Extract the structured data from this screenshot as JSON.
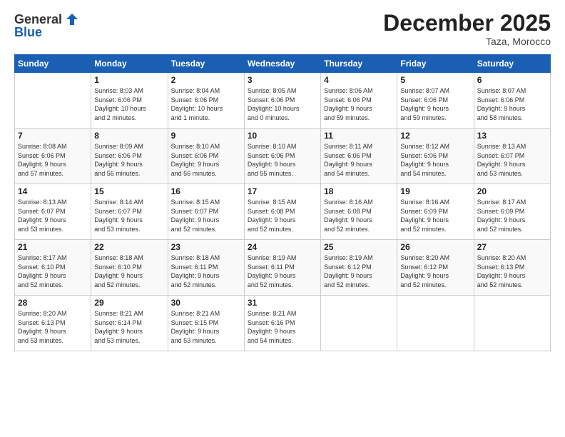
{
  "logo": {
    "general": "General",
    "blue": "Blue"
  },
  "header": {
    "month": "December 2025",
    "location": "Taza, Morocco"
  },
  "weekdays": [
    "Sunday",
    "Monday",
    "Tuesday",
    "Wednesday",
    "Thursday",
    "Friday",
    "Saturday"
  ],
  "weeks": [
    [
      {
        "day": "",
        "info": ""
      },
      {
        "day": "1",
        "info": "Sunrise: 8:03 AM\nSunset: 6:06 PM\nDaylight: 10 hours\nand 2 minutes."
      },
      {
        "day": "2",
        "info": "Sunrise: 8:04 AM\nSunset: 6:06 PM\nDaylight: 10 hours\nand 1 minute."
      },
      {
        "day": "3",
        "info": "Sunrise: 8:05 AM\nSunset: 6:06 PM\nDaylight: 10 hours\nand 0 minutes."
      },
      {
        "day": "4",
        "info": "Sunrise: 8:06 AM\nSunset: 6:06 PM\nDaylight: 9 hours\nand 59 minutes."
      },
      {
        "day": "5",
        "info": "Sunrise: 8:07 AM\nSunset: 6:06 PM\nDaylight: 9 hours\nand 59 minutes."
      },
      {
        "day": "6",
        "info": "Sunrise: 8:07 AM\nSunset: 6:06 PM\nDaylight: 9 hours\nand 58 minutes."
      }
    ],
    [
      {
        "day": "7",
        "info": "Sunrise: 8:08 AM\nSunset: 6:06 PM\nDaylight: 9 hours\nand 57 minutes."
      },
      {
        "day": "8",
        "info": "Sunrise: 8:09 AM\nSunset: 6:06 PM\nDaylight: 9 hours\nand 56 minutes."
      },
      {
        "day": "9",
        "info": "Sunrise: 8:10 AM\nSunset: 6:06 PM\nDaylight: 9 hours\nand 56 minutes."
      },
      {
        "day": "10",
        "info": "Sunrise: 8:10 AM\nSunset: 6:06 PM\nDaylight: 9 hours\nand 55 minutes."
      },
      {
        "day": "11",
        "info": "Sunrise: 8:11 AM\nSunset: 6:06 PM\nDaylight: 9 hours\nand 54 minutes."
      },
      {
        "day": "12",
        "info": "Sunrise: 8:12 AM\nSunset: 6:06 PM\nDaylight: 9 hours\nand 54 minutes."
      },
      {
        "day": "13",
        "info": "Sunrise: 8:13 AM\nSunset: 6:07 PM\nDaylight: 9 hours\nand 53 minutes."
      }
    ],
    [
      {
        "day": "14",
        "info": "Sunrise: 8:13 AM\nSunset: 6:07 PM\nDaylight: 9 hours\nand 53 minutes."
      },
      {
        "day": "15",
        "info": "Sunrise: 8:14 AM\nSunset: 6:07 PM\nDaylight: 9 hours\nand 53 minutes."
      },
      {
        "day": "16",
        "info": "Sunrise: 8:15 AM\nSunset: 6:07 PM\nDaylight: 9 hours\nand 52 minutes."
      },
      {
        "day": "17",
        "info": "Sunrise: 8:15 AM\nSunset: 6:08 PM\nDaylight: 9 hours\nand 52 minutes."
      },
      {
        "day": "18",
        "info": "Sunrise: 8:16 AM\nSunset: 6:08 PM\nDaylight: 9 hours\nand 52 minutes."
      },
      {
        "day": "19",
        "info": "Sunrise: 8:16 AM\nSunset: 6:09 PM\nDaylight: 9 hours\nand 52 minutes."
      },
      {
        "day": "20",
        "info": "Sunrise: 8:17 AM\nSunset: 6:09 PM\nDaylight: 9 hours\nand 52 minutes."
      }
    ],
    [
      {
        "day": "21",
        "info": "Sunrise: 8:17 AM\nSunset: 6:10 PM\nDaylight: 9 hours\nand 52 minutes."
      },
      {
        "day": "22",
        "info": "Sunrise: 8:18 AM\nSunset: 6:10 PM\nDaylight: 9 hours\nand 52 minutes."
      },
      {
        "day": "23",
        "info": "Sunrise: 8:18 AM\nSunset: 6:11 PM\nDaylight: 9 hours\nand 52 minutes."
      },
      {
        "day": "24",
        "info": "Sunrise: 8:19 AM\nSunset: 6:11 PM\nDaylight: 9 hours\nand 52 minutes."
      },
      {
        "day": "25",
        "info": "Sunrise: 8:19 AM\nSunset: 6:12 PM\nDaylight: 9 hours\nand 52 minutes."
      },
      {
        "day": "26",
        "info": "Sunrise: 8:20 AM\nSunset: 6:12 PM\nDaylight: 9 hours\nand 52 minutes."
      },
      {
        "day": "27",
        "info": "Sunrise: 8:20 AM\nSunset: 6:13 PM\nDaylight: 9 hours\nand 52 minutes."
      }
    ],
    [
      {
        "day": "28",
        "info": "Sunrise: 8:20 AM\nSunset: 6:13 PM\nDaylight: 9 hours\nand 53 minutes."
      },
      {
        "day": "29",
        "info": "Sunrise: 8:21 AM\nSunset: 6:14 PM\nDaylight: 9 hours\nand 53 minutes."
      },
      {
        "day": "30",
        "info": "Sunrise: 8:21 AM\nSunset: 6:15 PM\nDaylight: 9 hours\nand 53 minutes."
      },
      {
        "day": "31",
        "info": "Sunrise: 8:21 AM\nSunset: 6:16 PM\nDaylight: 9 hours\nand 54 minutes."
      },
      {
        "day": "",
        "info": ""
      },
      {
        "day": "",
        "info": ""
      },
      {
        "day": "",
        "info": ""
      }
    ]
  ]
}
